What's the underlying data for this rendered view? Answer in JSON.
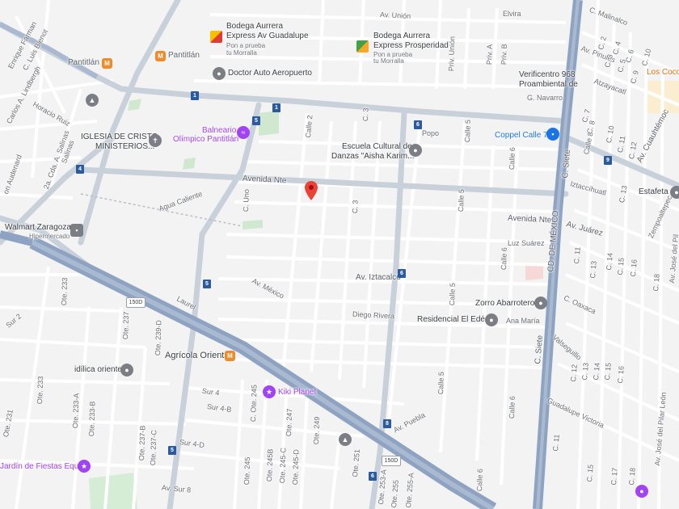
{
  "colors": {
    "background": "#f3f3f4",
    "street": "#ffffff",
    "main_road": "#c5cbd3",
    "highway": "#8fa3c0",
    "poi_purple": "#a142f4",
    "poi_blue": "#1a73e8",
    "marker_red": "#ea4335",
    "park_green": "#c8e6c9"
  },
  "streets": {
    "av_union": "Av. Unión",
    "elvira": "Elvira",
    "c_malinalco": "C. Malinalco",
    "av_pinules": "Av. Pinules",
    "atzayacatl": "Atzayacatl",
    "g_navarro": "G. Navarro",
    "priv_union": "Priv. Unión",
    "priv_a": "Priv. A",
    "priv_b": "Priv. B",
    "c_luis_blenot": "C. Luis Blenot",
    "enrique_farman": "Enrique Farman",
    "carlos_lindbergh": "Carlos A. Lindbergh",
    "horacio_ruiz": "Horacio Ruiz",
    "salinas": "Salinas",
    "cda_salinas": "2a. Cda. A. Salinas",
    "audenard": "on Audenard",
    "calle_2": "Calle 2",
    "c_3_top": "C. 3",
    "c_3_mid": "C. 3",
    "calle_4": "C. 4",
    "calle_5_top": "Calle 5",
    "calle_5_mid": "Calle 5",
    "calle_5_low": "Calle 5",
    "calle_6_top": "Calle 6",
    "calle_6_mid": "Calle 6",
    "calle_6_low": "Calle 6",
    "calle_8": "Calle 8",
    "c_uno": "C. Uno",
    "popo": "Popo",
    "avenida_nte_left": "Avenida Nte",
    "avenida_nte_right": "Avenida Nte",
    "agua_caliente": "Agua Caliente",
    "luz_suarez": "Luz Suárez",
    "av_iztacalco": "Av. Iztacalco",
    "av_mexico": "Av. México",
    "laurel": "Laurel",
    "diego_rivera": "Diego Rivera",
    "ana_maria": "Ana María",
    "av_puebla": "Av. Puebla",
    "c_siete_top": "C. Siete",
    "c_siete_low": "C. Siete",
    "cd_mexico": "CD. DE MÉXICO",
    "iztaccihuatl": "Iztaccíhuatl",
    "av_juarez": "Av. Juárez",
    "c_oaxaca": "C. Oaxaca",
    "valseguillo": "Valseguillo",
    "guadalupe_victoria": "Guadalupe Victoria",
    "av_cuauhtemoc": "Av. Cuauhtémoc",
    "zempoaltepec": "Zempoaltepec",
    "av_jose_pilar": "Av. José del Pilar León",
    "av_jose_pilar_top": "Av. José del Pil",
    "ote_233_top": "Ote. 233",
    "ote_233_mid": "Ote. 233",
    "ote_233a": "Ote. 233-A",
    "ote_233b": "Ote. 233-B",
    "ote_231": "Ote. 231",
    "ote_237": "Ote. 237",
    "ote_237b": "Ote. 237-B",
    "ote_237c": "Ote. 237-C",
    "ote_239d": "Ote. 239-D",
    "ote_245": "C. Ote. 245",
    "ote_245_low": "Ote. 245",
    "ote_245b": "Ote. 245B",
    "ote_245c": "Ote. 245-C",
    "ote_245d": "Ote. 245-D",
    "ote_247": "Ote. 247",
    "ote_249": "Ote. 249",
    "ote_251": "Ote. 251",
    "ote_253a": "Ote. 253-A",
    "ote_255": "Ote. 255",
    "ote_255a": "Ote. 255-A",
    "sur_4": "Sur 4",
    "sur_4b": "Sur 4-B",
    "sur_4d": "Sur 4-D",
    "sur_8": "Av. Sur 8",
    "sur_2": "Sur 2",
    "c_2": "C. 2",
    "c_4": "C. 4",
    "c_6": "C. 6",
    "c_10": "C. 10",
    "c_3r": "C. 3",
    "c_5": "C. 5",
    "c_7": "C. 7",
    "c_9": "C. 9",
    "c_8": "C. 8",
    "c_11": "C. 11",
    "c_12": "C. 12",
    "c_13": "C. 13",
    "c_14": "C. 14",
    "c_15": "C. 15",
    "c_16": "C. 16",
    "c_17": "C. 17",
    "c_18": "C. 18"
  },
  "pois": {
    "bodega1_name": "Bodega Aurrera",
    "bodega1_name2": "Express Av Guadalupe",
    "bodega1_sub1": "Pon a prueba",
    "bodega1_sub2": "tu Morralla",
    "bodega2_name": "Bodega Aurrera",
    "bodega2_name2": "Express Prosperidad",
    "bodega2_sub1": "Pon a prueba",
    "bodega2_sub2": "tu Morralla",
    "pantitlan_metro": "Pantitlán",
    "pantitlan_metro2": "Pantitlán",
    "doctor_auto": "Doctor Auto Aeropuerto",
    "verificentro1": "Verificentro 968",
    "verificentro2": "Proambiental de",
    "los_cocos": "Los Coco",
    "iglesia1": "IGLESIA DE CRISTO",
    "iglesia2": "MINISTERIOS...",
    "balneario1": "Balneario",
    "balneario2": "Olímpico Pantitlán",
    "escuela1": "Escuela Cultural de",
    "escuela2": "Danzas \"Aisha Karim...",
    "coppel": "Coppel Calle 7",
    "estafeta": "Estafeta",
    "walmart": "Walmart Zaragoza",
    "walmart_sub": "Hipermercado",
    "zorro": "Zorro Abarrotero",
    "residencial": "Residencial El Edén",
    "agricola": "Agrícola Oriental",
    "idilica": "idílica oriente",
    "kiki": "Kiki Planet",
    "jardin": "Jardín de Fiestas Equus"
  },
  "shields": {
    "r1a": "1",
    "r1b": "1",
    "r4": "4",
    "r5a": "5",
    "r5b": "5",
    "r5c": "5",
    "r6a": "6",
    "r6b": "6",
    "r6c": "6",
    "r8": "8",
    "r9": "9",
    "hwy1": "150D",
    "hwy2": "150D"
  }
}
